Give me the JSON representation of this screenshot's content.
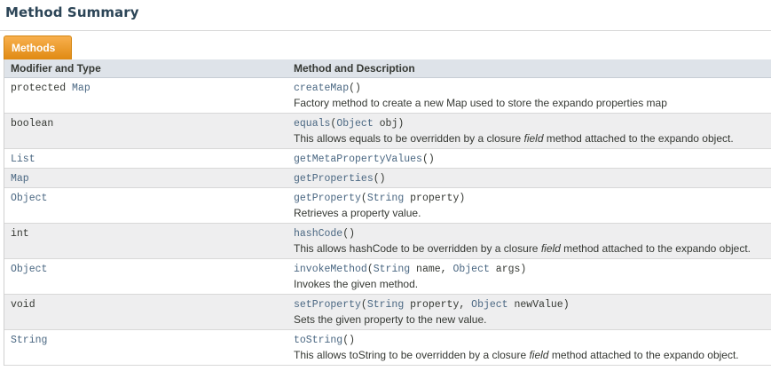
{
  "heading": "Method Summary",
  "tab_label": "Methods",
  "columns": {
    "col1": "Modifier and Type",
    "col2": "Method and Description"
  },
  "rows": [
    {
      "mod_a": "protected ",
      "mod_b": "Map",
      "name": "createMap",
      "p1": "()",
      "p2": "",
      "p3": "",
      "p4": "",
      "p5": "",
      "d1": "Factory method to create a new Map used to store the expando properties map",
      "d_it": "",
      "d2": ""
    },
    {
      "mod_a": "boolean",
      "mod_b": "",
      "name": "equals",
      "p1": "(",
      "p2": "Object",
      "p3": " obj)",
      "p4": "",
      "p5": "",
      "d1": "This allows equals to be overridden by a closure ",
      "d_it": "field",
      "d2": " method attached to the expando object."
    },
    {
      "mod_a": "",
      "mod_b": "List",
      "name": "getMetaPropertyValues",
      "p1": "()",
      "p2": "",
      "p3": "",
      "p4": "",
      "p5": "",
      "d1": "",
      "d_it": "",
      "d2": ""
    },
    {
      "mod_a": "",
      "mod_b": "Map",
      "name": "getProperties",
      "p1": "()",
      "p2": "",
      "p3": "",
      "p4": "",
      "p5": "",
      "d1": "",
      "d_it": "",
      "d2": ""
    },
    {
      "mod_a": "",
      "mod_b": "Object",
      "name": "getProperty",
      "p1": "(",
      "p2": "String",
      "p3": " property)",
      "p4": "",
      "p5": "",
      "d1": "Retrieves a property value.",
      "d_it": "",
      "d2": ""
    },
    {
      "mod_a": "int",
      "mod_b": "",
      "name": "hashCode",
      "p1": "()",
      "p2": "",
      "p3": "",
      "p4": "",
      "p5": "",
      "d1": "This allows hashCode to be overridden by a closure ",
      "d_it": "field",
      "d2": " method attached to the expando object."
    },
    {
      "mod_a": "",
      "mod_b": "Object",
      "name": "invokeMethod",
      "p1": "(",
      "p2": "String",
      "p3": " name, ",
      "p4": "Object",
      "p5": " args)",
      "d1": "Invokes the given method.",
      "d_it": "",
      "d2": ""
    },
    {
      "mod_a": "void",
      "mod_b": "",
      "name": "setProperty",
      "p1": "(",
      "p2": "String",
      "p3": " property, ",
      "p4": "Object",
      "p5": " newValue)",
      "d1": "Sets the given property to the new value.",
      "d_it": "",
      "d2": ""
    },
    {
      "mod_a": "",
      "mod_b": "String",
      "name": "toString",
      "p1": "()",
      "p2": "",
      "p3": "",
      "p4": "",
      "p5": "",
      "d1": "This allows toString to be overridden by a closure ",
      "d_it": "field",
      "d2": " method attached to the expando object."
    }
  ]
}
